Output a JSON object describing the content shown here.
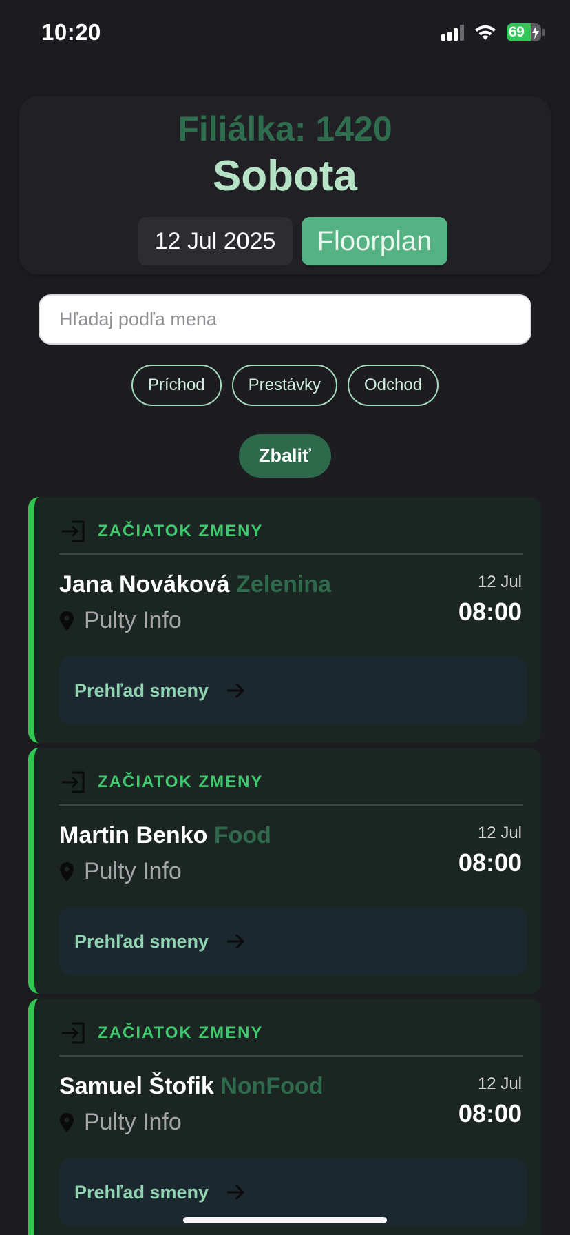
{
  "status_bar": {
    "time": "10:20",
    "battery_percent": "69",
    "battery_level": 0.69
  },
  "header": {
    "branch": "Filiálka: 1420",
    "day": "Sobota",
    "date": "12 Jul 2025",
    "floorplan_label": "Floorplan"
  },
  "search": {
    "placeholder": "Hľadaj podľa mena"
  },
  "filters": [
    "Príchod",
    "Prestávky",
    "Odchod"
  ],
  "collapse_label": "Zbaliť",
  "shifts": [
    {
      "status": "ZAČIATOK ZMENY",
      "name": "Jana Nováková",
      "department": "Zelenina",
      "location": "Pulty Info",
      "date": "12 Jul",
      "time": "08:00",
      "overview_label": "Prehľad smeny"
    },
    {
      "status": "ZAČIATOK ZMENY",
      "name": "Martin Benko",
      "department": "Food",
      "location": "Pulty Info",
      "date": "12 Jul",
      "time": "08:00",
      "overview_label": "Prehľad smeny"
    },
    {
      "status": "ZAČIATOK ZMENY",
      "name": "Samuel Štofik",
      "department": "NonFood",
      "location": "Pulty Info",
      "date": "12 Jul",
      "time": "08:00",
      "overview_label": "Prehľad smeny"
    }
  ],
  "icons": {
    "status_icons": [
      "cellular-signal-icon",
      "wifi-icon",
      "battery-charging-icon"
    ],
    "shift_status": "enter-icon",
    "location": "location-pin-icon",
    "overview": "arrow-right-icon"
  },
  "colors": {
    "background": "#1c1c21",
    "accent_green": "#31c552",
    "floorplan_button": "#55b283",
    "collapse_button": "#2d6a4c",
    "status_text": "#3fca70"
  }
}
